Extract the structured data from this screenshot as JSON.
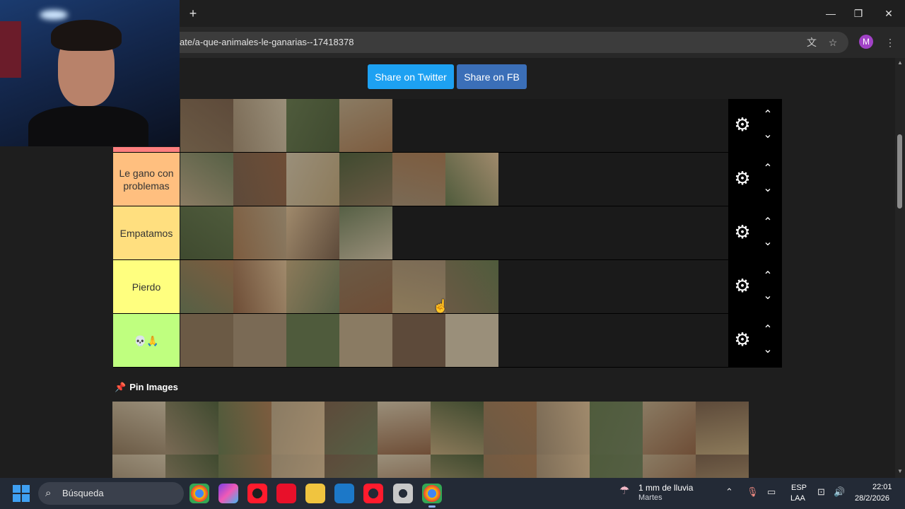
{
  "browser": {
    "url": "ate/a-que-animales-le-ganarias--17418378",
    "profile_initial": "M",
    "new_tab_icon": "plus-icon"
  },
  "share": {
    "twitter_label": "Share on Twitter",
    "fb_label": "Share on FB"
  },
  "tiers": [
    {
      "label": "",
      "color": "#ff7f7f",
      "items": [
        "anteater",
        "andean-condor",
        "giant-otter",
        "geese"
      ]
    },
    {
      "label": "Le gano con problemas",
      "color": "#ffbf7f",
      "items": [
        "honey-badger",
        "mandrill",
        "crocodile",
        "maned-wolf",
        "cassowary",
        "harpy-eagle"
      ]
    },
    {
      "label": "Empatamos",
      "color": "#ffdf7f",
      "items": [
        "sun-bear",
        "african-wild-dog",
        "wolverine",
        "caracal"
      ]
    },
    {
      "label": "Pierdo",
      "color": "#ffff7f",
      "items": [
        "anaconda",
        "komodo-dragon",
        "snow-leopard",
        "panda",
        "german-shepherd",
        "orangutan"
      ]
    },
    {
      "label": "💀🙏",
      "color": "#bfff7f",
      "items": [
        "polar-bear",
        "tiger",
        "kangal-dog",
        "cougar",
        "hyena",
        "rottweiler"
      ]
    }
  ],
  "pin": {
    "title": "Pin Images",
    "items": [
      "cheetah",
      "moose",
      "mongoose",
      "blue-bird",
      "kangaroo",
      "donkey",
      "ram",
      "deer",
      "alligator",
      "tasmanian-devil",
      "raccoon",
      "spider-monkey",
      "skunk",
      "red-animal",
      "capybara",
      "llama",
      "peacock-feathers",
      "peacock",
      "camel",
      "koala",
      "rabbit",
      "zebra",
      "bird",
      "turtle"
    ]
  },
  "taskbar": {
    "search_placeholder": "Búsqueda",
    "weather_line1": "1 mm de lluvia",
    "weather_line2": "Martes",
    "lang_line1": "ESP",
    "lang_line2": "LAA",
    "time": "22:01",
    "date": "28/2/2026"
  }
}
